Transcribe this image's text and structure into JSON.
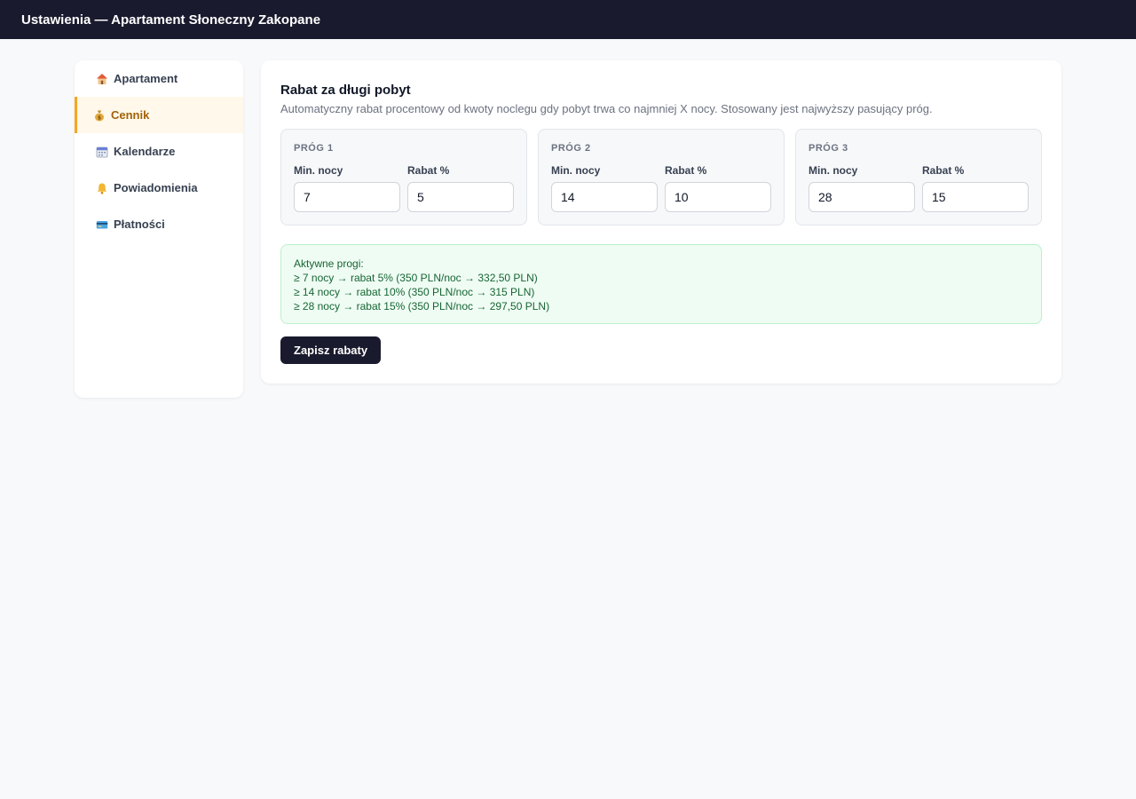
{
  "header": {
    "title": "Ustawienia — Apartament Słoneczny Zakopane"
  },
  "sidebar": {
    "items": [
      {
        "label": "Apartament",
        "icon": "house-icon",
        "active": false
      },
      {
        "label": "Cennik",
        "icon": "money-bag-icon",
        "active": true
      },
      {
        "label": "Kalendarze",
        "icon": "calendar-icon",
        "active": false
      },
      {
        "label": "Powiadomienia",
        "icon": "bell-icon",
        "active": false
      },
      {
        "label": "Płatności",
        "icon": "credit-card-icon",
        "active": false
      }
    ]
  },
  "main": {
    "title": "Rabat za długi pobyt",
    "description": "Automatyczny rabat procentowy od kwoty noclegu gdy pobyt trwa co najmniej X nocy. Stosowany jest najwyższy pasujący próg.",
    "tiers": [
      {
        "title": "PRÓG 1",
        "min_label": "Min. nocy",
        "min_value": "7",
        "rabat_label": "Rabat %",
        "rabat_value": "5"
      },
      {
        "title": "PRÓG 2",
        "min_label": "Min. nocy",
        "min_value": "14",
        "rabat_label": "Rabat %",
        "rabat_value": "10"
      },
      {
        "title": "PRÓG 3",
        "min_label": "Min. nocy",
        "min_value": "28",
        "rabat_label": "Rabat %",
        "rabat_value": "15"
      }
    ],
    "summary": {
      "heading": "Aktywne progi:",
      "lines": [
        "≥ 7 nocy → rabat 5% (350 PLN/noc → 332,50 PLN)",
        "≥ 14 nocy → rabat 10% (350 PLN/noc → 315 PLN)",
        "≥ 28 nocy → rabat 15% (350 PLN/noc → 297,50 PLN)"
      ]
    },
    "save_label": "Zapisz rabaty"
  },
  "colors": {
    "topbar": "#1a1a2e",
    "accent": "#f5a623",
    "summary_bg": "#effcf3",
    "summary_text": "#166534"
  }
}
